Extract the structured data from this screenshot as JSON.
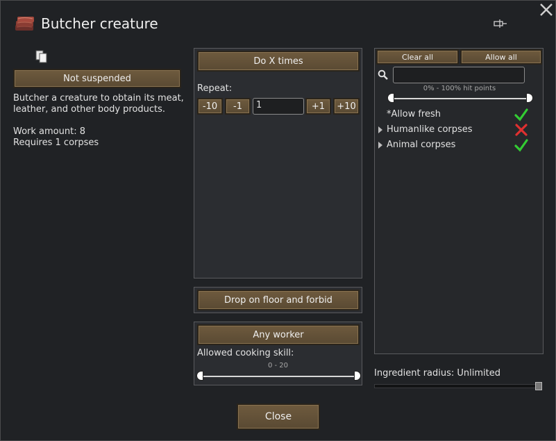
{
  "window": {
    "title": "Butcher creature",
    "close_icon": "close-icon",
    "pin_icon": "pin-icon",
    "bill_icon": "raw-meat-icon",
    "copy_icon": "copy-icon"
  },
  "left": {
    "suspend_button": "Not suspended",
    "description": "Butcher a creature to obtain its meat, leather, and other body products.",
    "work_amount": "Work amount: 8",
    "requires": "Requires 1 corpses"
  },
  "middle": {
    "repeat_mode_button": "Do X times",
    "repeat_label": "Repeat:",
    "minus10": "-10",
    "minus1": "-1",
    "count_value": "1",
    "plus1": "+1",
    "plus10": "+10",
    "store_mode_button": "Drop on floor and forbid",
    "worker_button": "Any worker",
    "skill_label": "Allowed cooking skill:",
    "skill_range": "0 - 20",
    "skill_range_min": 0,
    "skill_range_max": 20
  },
  "filter": {
    "clear_all": "Clear all",
    "allow_all": "Allow all",
    "search_placeholder": "",
    "hitpoints_range": "0% - 100% hit points",
    "items": [
      {
        "label": "*Allow fresh",
        "state": "allowed",
        "expandable": false
      },
      {
        "label": "Humanlike corpses",
        "state": "disallowed",
        "expandable": true
      },
      {
        "label": "Animal corpses",
        "state": "allowed",
        "expandable": true
      }
    ],
    "ingredient_radius": "Ingredient radius: Unlimited"
  },
  "footer": {
    "close_button": "Close"
  },
  "colors": {
    "check": "#33cc33",
    "cross": "#e03030",
    "button": "#6e5a3e",
    "background": "#202225"
  }
}
